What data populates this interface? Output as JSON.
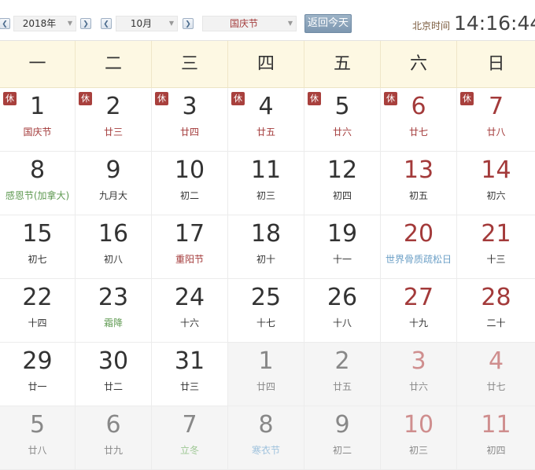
{
  "toolbar": {
    "prev_year_icon": "chevron-left-icon",
    "year_value": "2018年",
    "next_year_icon": "chevron-right-icon",
    "prev_month_icon": "chevron-left-icon",
    "month_value": "10月",
    "next_month_icon": "chevron-right-icon",
    "holiday_value": "国庆节",
    "today_label": "返回今天",
    "clock_label": "北京时间",
    "clock_time": "14:16:44",
    "accent_color": "#a33a3a"
  },
  "weekdays": [
    "一",
    "二",
    "三",
    "四",
    "五",
    "六",
    "日"
  ],
  "rows": [
    [
      {
        "day": "1",
        "sub": "国庆节",
        "sub_type": "festival",
        "badge": "休",
        "weekend": false,
        "other": false
      },
      {
        "day": "2",
        "sub": "廿三",
        "sub_type": "festival",
        "badge": "休",
        "weekend": false,
        "other": false
      },
      {
        "day": "3",
        "sub": "廿四",
        "sub_type": "festival",
        "badge": "休",
        "weekend": false,
        "other": false
      },
      {
        "day": "4",
        "sub": "廿五",
        "sub_type": "festival",
        "badge": "休",
        "weekend": false,
        "other": false
      },
      {
        "day": "5",
        "sub": "廿六",
        "sub_type": "festival",
        "badge": "休",
        "weekend": false,
        "other": false
      },
      {
        "day": "6",
        "sub": "廿七",
        "sub_type": "festival",
        "badge": "休",
        "weekend": true,
        "other": false
      },
      {
        "day": "7",
        "sub": "廿八",
        "sub_type": "festival",
        "badge": "休",
        "weekend": true,
        "other": false
      }
    ],
    [
      {
        "day": "8",
        "sub": "感恩节(加拿大)",
        "sub_type": "solar",
        "badge": "",
        "weekend": false,
        "other": false
      },
      {
        "day": "9",
        "sub": "九月大",
        "sub_type": "",
        "badge": "",
        "weekend": false,
        "other": false
      },
      {
        "day": "10",
        "sub": "初二",
        "sub_type": "",
        "badge": "",
        "weekend": false,
        "other": false
      },
      {
        "day": "11",
        "sub": "初三",
        "sub_type": "",
        "badge": "",
        "weekend": false,
        "other": false
      },
      {
        "day": "12",
        "sub": "初四",
        "sub_type": "",
        "badge": "",
        "weekend": false,
        "other": false
      },
      {
        "day": "13",
        "sub": "初五",
        "sub_type": "",
        "badge": "",
        "weekend": true,
        "other": false
      },
      {
        "day": "14",
        "sub": "初六",
        "sub_type": "",
        "badge": "",
        "weekend": true,
        "other": false
      }
    ],
    [
      {
        "day": "15",
        "sub": "初七",
        "sub_type": "",
        "badge": "",
        "weekend": false,
        "other": false
      },
      {
        "day": "16",
        "sub": "初八",
        "sub_type": "",
        "badge": "",
        "weekend": false,
        "other": false
      },
      {
        "day": "17",
        "sub": "重阳节",
        "sub_type": "festival",
        "badge": "",
        "weekend": false,
        "other": false
      },
      {
        "day": "18",
        "sub": "初十",
        "sub_type": "",
        "badge": "",
        "weekend": false,
        "other": false
      },
      {
        "day": "19",
        "sub": "十一",
        "sub_type": "",
        "badge": "",
        "weekend": false,
        "other": false
      },
      {
        "day": "20",
        "sub": "世界骨质疏松日",
        "sub_type": "intl",
        "badge": "",
        "weekend": true,
        "other": false
      },
      {
        "day": "21",
        "sub": "十三",
        "sub_type": "",
        "badge": "",
        "weekend": true,
        "other": false
      }
    ],
    [
      {
        "day": "22",
        "sub": "十四",
        "sub_type": "",
        "badge": "",
        "weekend": false,
        "other": false
      },
      {
        "day": "23",
        "sub": "霜降",
        "sub_type": "solar",
        "badge": "",
        "weekend": false,
        "other": false
      },
      {
        "day": "24",
        "sub": "十六",
        "sub_type": "",
        "badge": "",
        "weekend": false,
        "other": false
      },
      {
        "day": "25",
        "sub": "十七",
        "sub_type": "",
        "badge": "",
        "weekend": false,
        "other": false
      },
      {
        "day": "26",
        "sub": "十八",
        "sub_type": "",
        "badge": "",
        "weekend": false,
        "other": false
      },
      {
        "day": "27",
        "sub": "十九",
        "sub_type": "",
        "badge": "",
        "weekend": true,
        "other": false
      },
      {
        "day": "28",
        "sub": "二十",
        "sub_type": "",
        "badge": "",
        "weekend": true,
        "other": false
      }
    ],
    [
      {
        "day": "29",
        "sub": "廿一",
        "sub_type": "",
        "badge": "",
        "weekend": false,
        "other": false
      },
      {
        "day": "30",
        "sub": "廿二",
        "sub_type": "",
        "badge": "",
        "weekend": false,
        "other": false
      },
      {
        "day": "31",
        "sub": "廿三",
        "sub_type": "",
        "badge": "",
        "weekend": false,
        "other": false
      },
      {
        "day": "1",
        "sub": "廿四",
        "sub_type": "",
        "badge": "",
        "weekend": false,
        "other": true
      },
      {
        "day": "2",
        "sub": "廿五",
        "sub_type": "",
        "badge": "",
        "weekend": false,
        "other": true
      },
      {
        "day": "3",
        "sub": "廿六",
        "sub_type": "",
        "badge": "",
        "weekend": true,
        "other": true
      },
      {
        "day": "4",
        "sub": "廿七",
        "sub_type": "",
        "badge": "",
        "weekend": true,
        "other": true
      }
    ],
    [
      {
        "day": "5",
        "sub": "廿八",
        "sub_type": "",
        "badge": "",
        "weekend": false,
        "other": true
      },
      {
        "day": "6",
        "sub": "廿九",
        "sub_type": "",
        "badge": "",
        "weekend": false,
        "other": true
      },
      {
        "day": "7",
        "sub": "立冬",
        "sub_type": "solar",
        "badge": "",
        "weekend": false,
        "other": true
      },
      {
        "day": "8",
        "sub": "寒衣节",
        "sub_type": "intl",
        "badge": "",
        "weekend": false,
        "other": true
      },
      {
        "day": "9",
        "sub": "初二",
        "sub_type": "",
        "badge": "",
        "weekend": false,
        "other": true
      },
      {
        "day": "10",
        "sub": "初三",
        "sub_type": "",
        "badge": "",
        "weekend": true,
        "other": true
      },
      {
        "day": "11",
        "sub": "初四",
        "sub_type": "",
        "badge": "",
        "weekend": true,
        "other": true
      }
    ]
  ]
}
